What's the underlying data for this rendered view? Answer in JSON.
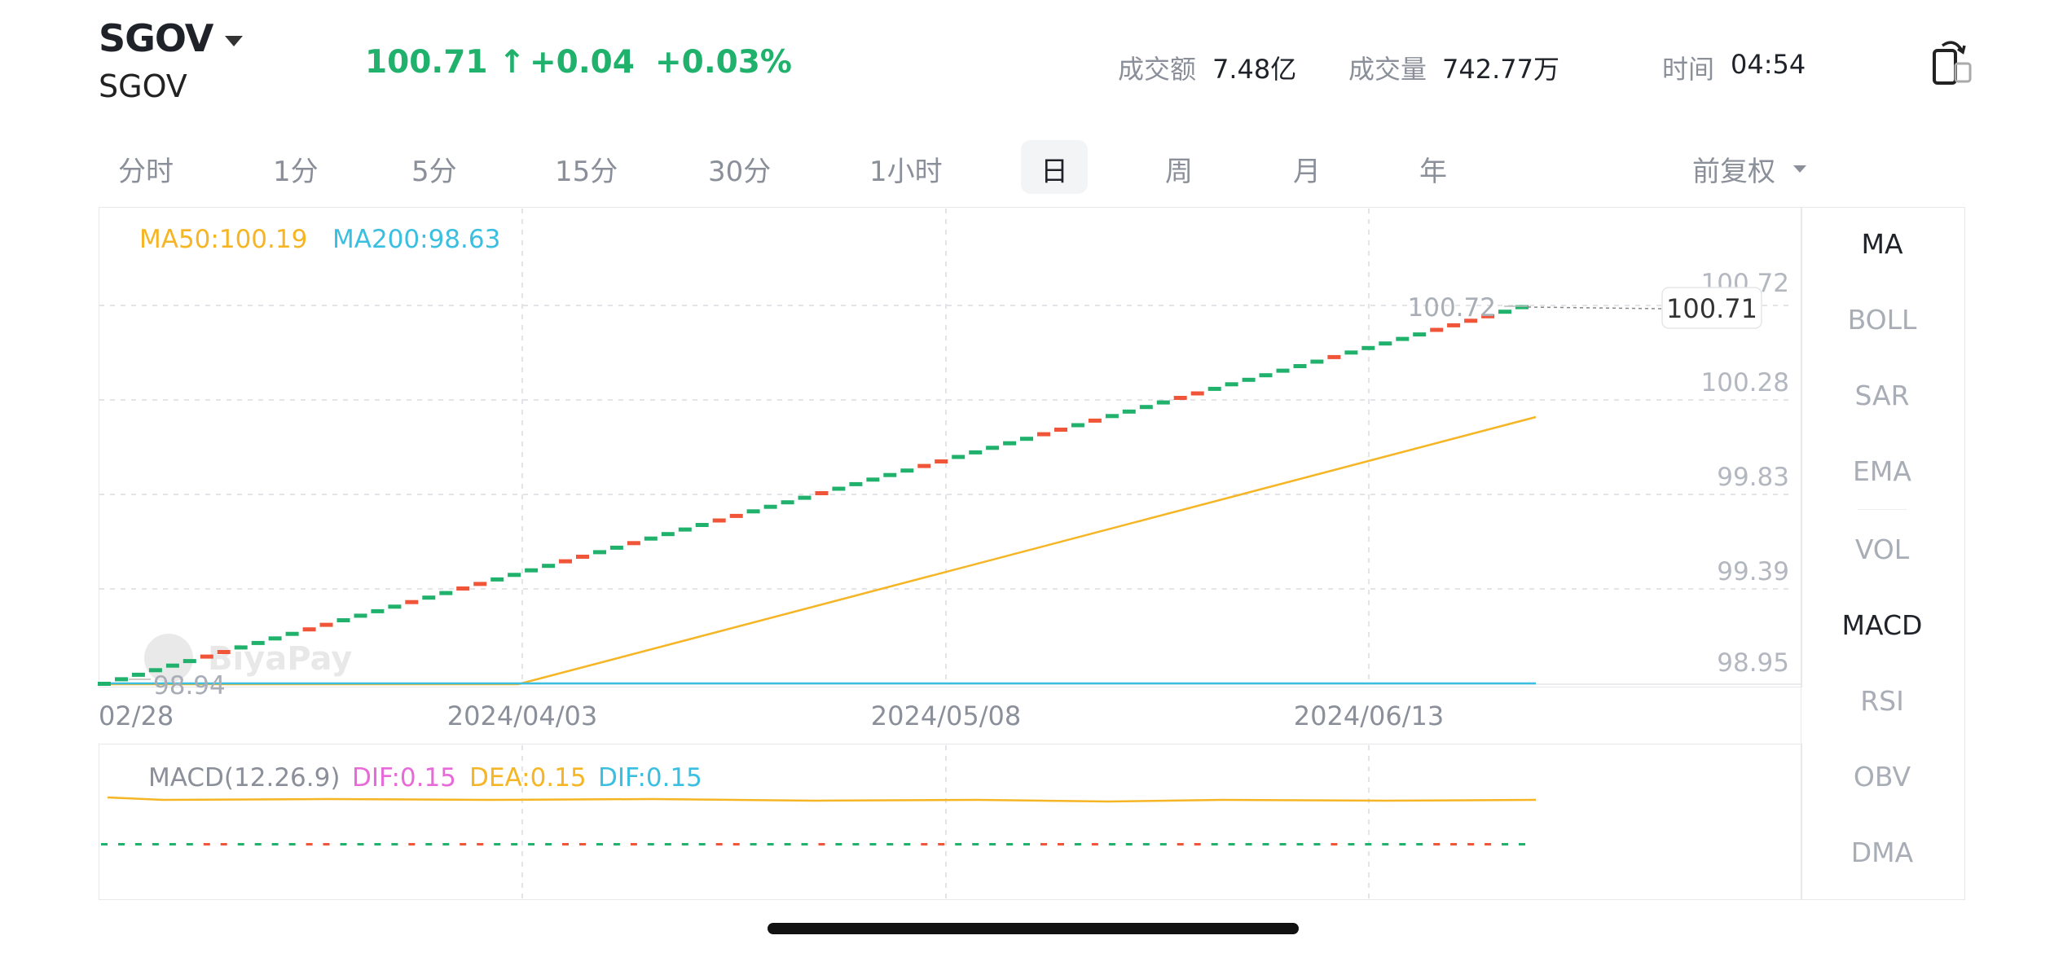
{
  "header": {
    "ticker": "SGOV",
    "ticker_sub": "SGOV",
    "price": "100.71 ↑",
    "change": "+0.04",
    "change_pct": "+0.03%",
    "turnover_label": "成交额",
    "turnover_value": "7.48亿",
    "volume_label": "成交量",
    "volume_value": "742.77万",
    "time_label": "时间",
    "time_value": "04:54",
    "up_color": "#20b26c",
    "icon": "rotate-screen-icon"
  },
  "tabs": [
    {
      "label": "分时"
    },
    {
      "label": "1分"
    },
    {
      "label": "5分"
    },
    {
      "label": "15分"
    },
    {
      "label": "30分"
    },
    {
      "label": "1小时"
    },
    {
      "label": "日"
    },
    {
      "label": "周"
    },
    {
      "label": "月"
    },
    {
      "label": "年"
    }
  ],
  "active_tab": "日",
  "adjust": {
    "label": "前复权"
  },
  "indicators": {
    "ma50_label": "MA50:100.19",
    "ma200_label": "MA200:98.63",
    "ma50_color": "#f5b524",
    "ma200_color": "#3bbfe0"
  },
  "macd": {
    "label": "MACD(12.26.9)",
    "dif": "DIF:0.15",
    "dea": "DEA:0.15",
    "dif2": "DIF:0.15",
    "dif_color": "#e86ad8",
    "dea_color": "#f5b524",
    "dif2_color": "#3bbfe0"
  },
  "sidebar": {
    "items": [
      {
        "label": "MA",
        "active": true
      },
      {
        "label": "BOLL",
        "active": false
      },
      {
        "label": "SAR",
        "active": false
      },
      {
        "label": "EMA",
        "active": false
      },
      {
        "label": "VOL",
        "active": false
      },
      {
        "label": "MACD",
        "active": true
      },
      {
        "label": "RSI",
        "active": false
      },
      {
        "label": "OBV",
        "active": false
      },
      {
        "label": "DMA",
        "active": false
      }
    ]
  },
  "watermark": "BiyaPay",
  "chart_data": {
    "type": "candlestick",
    "y_ticks": [
      "100.72",
      "100.28",
      "99.83",
      "99.39",
      "98.95"
    ],
    "x_ticks": [
      "02/28",
      "2024/04/03",
      "2024/05/08",
      "2024/06/13"
    ],
    "ylim": [
      98.95,
      100.72
    ],
    "high_label": "100.72",
    "low_label": "98.94",
    "last_price_label": "100.71",
    "close_start": 98.95,
    "close_end": 100.71,
    "ma50_range": [
      98.95,
      100.19
    ],
    "ma200_level": 98.95,
    "up_color": "#20b26c",
    "down_color": "#f0553a"
  }
}
